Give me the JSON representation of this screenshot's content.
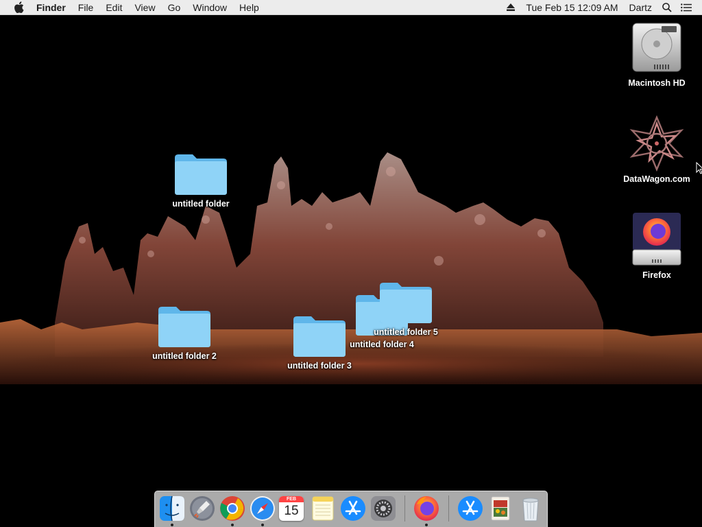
{
  "menubar": {
    "apple_icon": "apple-icon",
    "app_name": "Finder",
    "menus": [
      "File",
      "Edit",
      "View",
      "Go",
      "Window",
      "Help"
    ],
    "eject_icon": "eject-icon",
    "datetime": "Tue Feb 15  12:09 AM",
    "user": "Dartz",
    "search_icon": "spotlight-search-icon",
    "list_icon": "notification-center-icon",
    "background_color": "#ececec"
  },
  "desktop": {
    "icons": [
      {
        "label": "Macintosh HD",
        "icon": "hard-drive-icon"
      },
      {
        "label": "DataWagon.com",
        "icon": "datawagon-icon"
      },
      {
        "label": "Firefox",
        "icon": "firefox-volume-icon"
      },
      {
        "label": "untitled folder",
        "icon": "folder-icon"
      },
      {
        "label": "untitled folder 2",
        "icon": "folder-icon"
      },
      {
        "label": "untitled folder 3",
        "icon": "folder-icon"
      },
      {
        "label": "untitled folder 4",
        "icon": "folder-icon"
      },
      {
        "label": "untitled folder 5",
        "icon": "folder-icon"
      }
    ],
    "folder_color": "#7fcaf3"
  },
  "dock": {
    "items": [
      {
        "name": "Finder",
        "icon": "finder-icon",
        "running": true
      },
      {
        "name": "Launchpad",
        "icon": "launchpad-icon",
        "running": false
      },
      {
        "name": "Google Chrome",
        "icon": "chrome-icon",
        "running": true
      },
      {
        "name": "Safari",
        "icon": "safari-icon",
        "running": true
      },
      {
        "name": "Calendar",
        "icon": "calendar-icon",
        "running": false,
        "month": "FEB",
        "day": "15"
      },
      {
        "name": "Notes",
        "icon": "notes-icon",
        "running": false
      },
      {
        "name": "App Store",
        "icon": "app-store-icon",
        "running": false
      },
      {
        "name": "System Preferences",
        "icon": "system-preferences-icon",
        "running": false
      },
      {
        "name": "Firefox",
        "icon": "firefox-icon",
        "running": true
      },
      {
        "name": "Applications",
        "icon": "applications-folder-icon",
        "running": false
      },
      {
        "name": "Downloads",
        "icon": "downloads-stack-icon",
        "running": false
      },
      {
        "name": "Trash",
        "icon": "trash-icon",
        "running": false
      }
    ]
  }
}
